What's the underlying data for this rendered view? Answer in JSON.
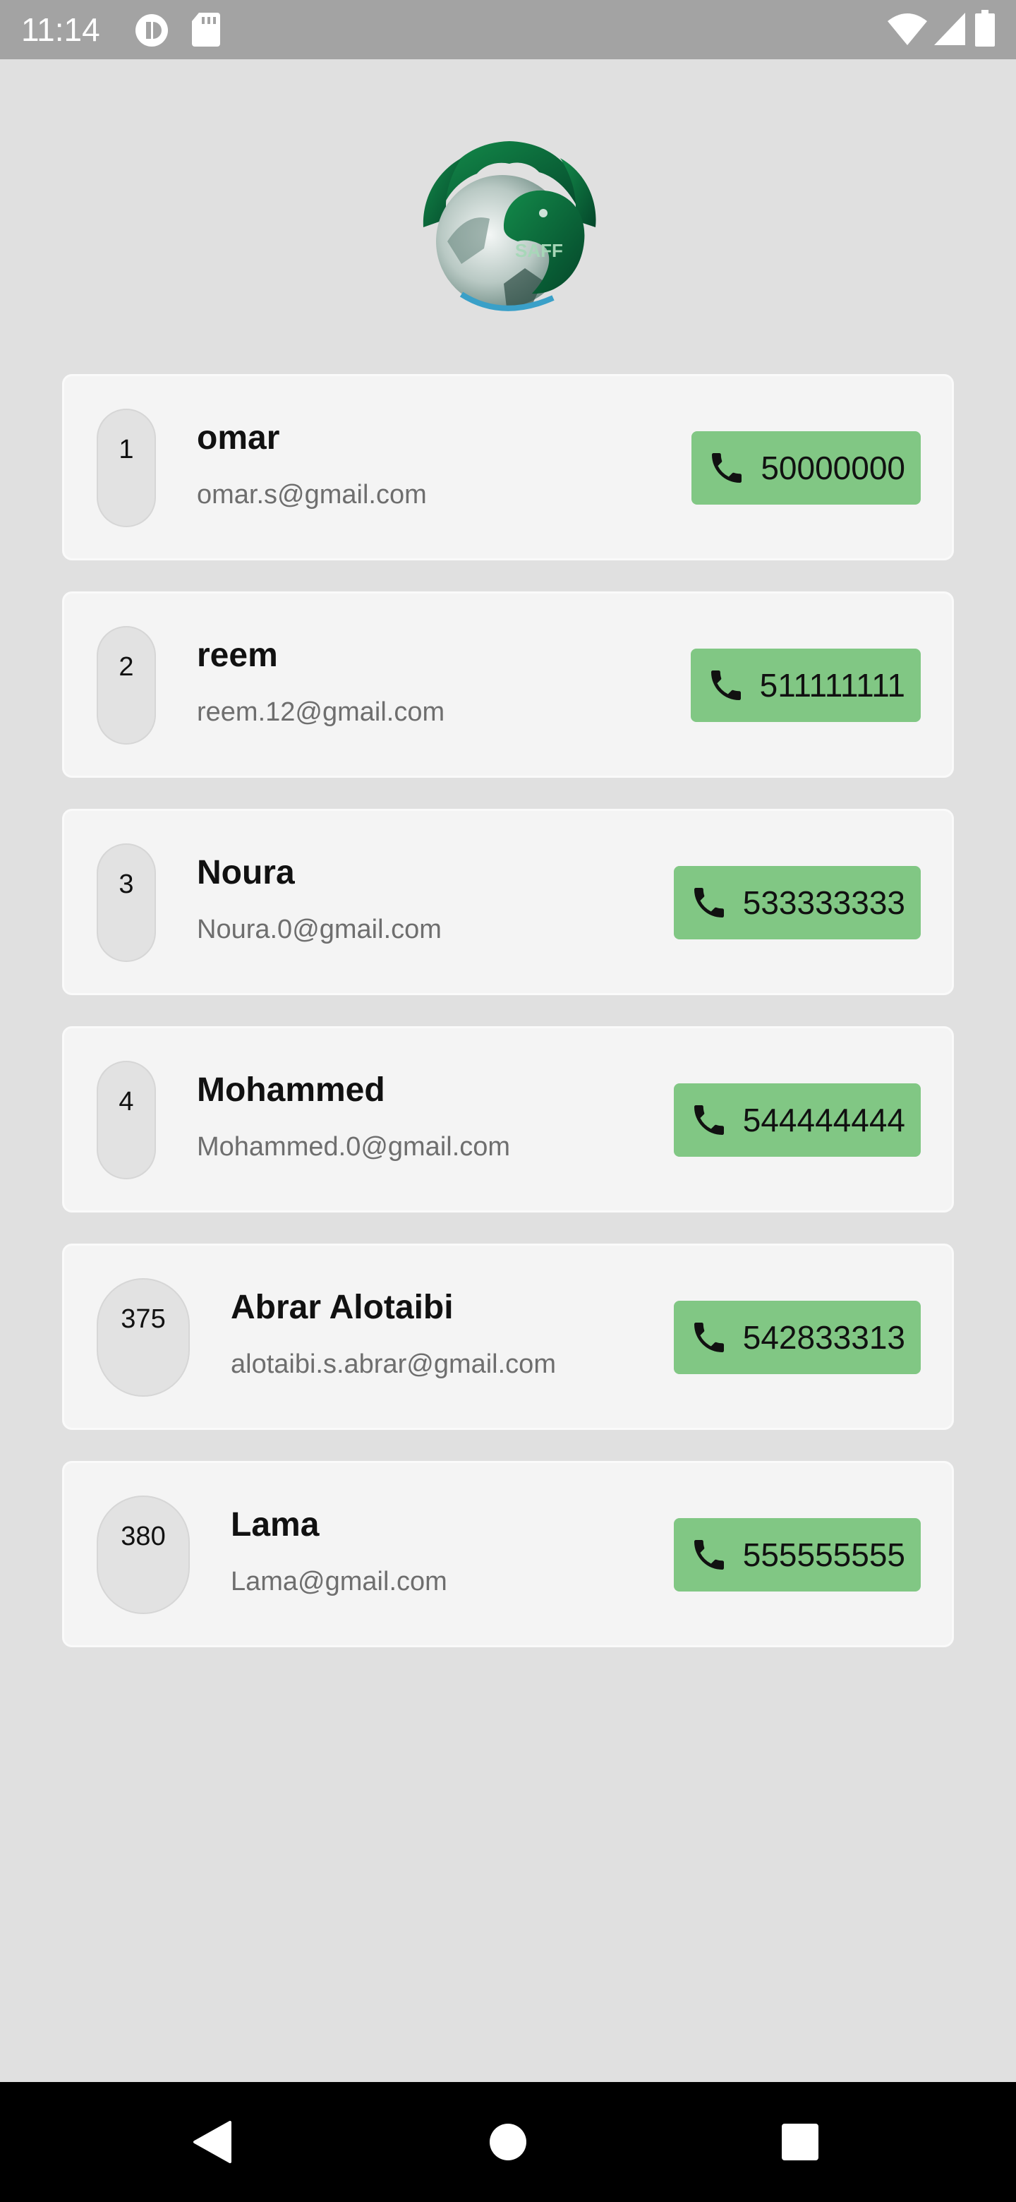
{
  "status_bar": {
    "time": "11:14",
    "left_icons": [
      "circle-app-icon",
      "sd-card-icon"
    ],
    "right_icons": [
      "wifi-icon",
      "cell-signal-icon",
      "battery-icon"
    ]
  },
  "logo": {
    "text": "SAFF",
    "colors": {
      "primary": "#0b6b3a",
      "dark": "#074d2a"
    }
  },
  "contacts": [
    {
      "id": "1",
      "name": "omar",
      "email": "omar.s@gmail.com",
      "phone": "50000000"
    },
    {
      "id": "2",
      "name": "reem",
      "email": "reem.12@gmail.com",
      "phone": "511111111"
    },
    {
      "id": "3",
      "name": "Noura",
      "email": "Noura.0@gmail.com",
      "phone": "533333333"
    },
    {
      "id": "4",
      "name": "Mohammed",
      "email": "Mohammed.0@gmail.com",
      "phone": "544444444"
    },
    {
      "id": "375",
      "name": "Abrar Alotaibi",
      "email": "alotaibi.s.abrar@gmail.com",
      "phone": "542833313"
    },
    {
      "id": "380",
      "name": "Lama",
      "email": "Lama@gmail.com",
      "phone": "555555555"
    }
  ],
  "colors": {
    "background": "#e0e0e0",
    "card": "#f4f4f4",
    "call_button": "#81c784",
    "status_bar": "#a3a3a3",
    "nav_bar": "#000000"
  },
  "nav": {
    "buttons": [
      "back-icon",
      "home-icon",
      "recents-icon"
    ]
  }
}
